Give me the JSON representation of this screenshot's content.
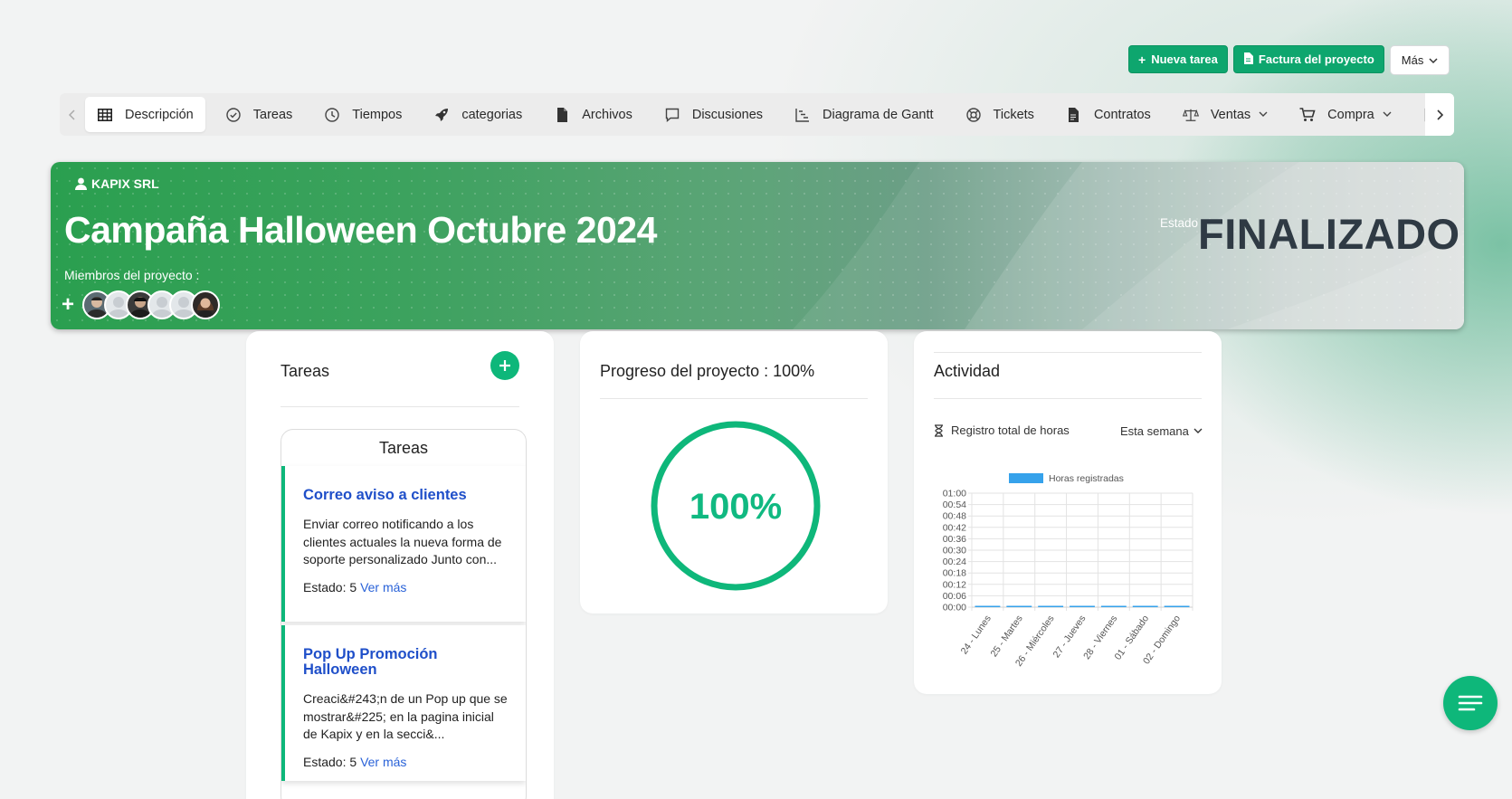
{
  "actions": {
    "new_task": "Nueva tarea",
    "invoice": "Factura del proyecto",
    "more": "Más"
  },
  "tabs": [
    {
      "label": "Descripción",
      "icon": "grid-icon"
    },
    {
      "label": "Tareas",
      "icon": "check-circle-icon"
    },
    {
      "label": "Tiempos",
      "icon": "clock-icon"
    },
    {
      "label": "categorias",
      "icon": "rocket-icon"
    },
    {
      "label": "Archivos",
      "icon": "file-icon"
    },
    {
      "label": "Discusiones",
      "icon": "chat-icon"
    },
    {
      "label": "Diagrama de Gantt",
      "icon": "gantt-icon"
    },
    {
      "label": "Tickets",
      "icon": "lifebuoy-icon"
    },
    {
      "label": "Contratos",
      "icon": "contract-icon"
    },
    {
      "label": "Ventas",
      "icon": "scale-icon"
    },
    {
      "label": "Compra",
      "icon": "cart-icon"
    }
  ],
  "hero": {
    "client": "KAPIX SRL",
    "title": "Campaña Halloween Octubre 2024",
    "members_label": "Miembros del proyecto :",
    "status_label": "Estado",
    "status_value": "FINALIZADO"
  },
  "tasks_card": {
    "title": "Tareas",
    "inner_title": "Tareas",
    "items": [
      {
        "title": "Correo aviso a clientes",
        "desc": "Enviar correo notificando a los clientes actuales la nueva forma de soporte personalizado Junto con...",
        "status_label": "Estado:",
        "status_value": "5",
        "more": "Ver más"
      },
      {
        "title": "Pop Up Promoción Halloween",
        "desc": "Creaci&#243;n de un Pop up que se mostrar&#225; en la pagina inicial de Kapix y en la secci&...",
        "status_label": "Estado:",
        "status_value": "5",
        "more": "Ver más"
      }
    ]
  },
  "progress_card": {
    "title": "Progreso del proyecto : 100%",
    "value_text": "100%",
    "progress": 100,
    "color": "#0eb77a"
  },
  "activity_card": {
    "title": "Actividad",
    "subtitle": "Registro total de horas",
    "range": "Esta semana"
  },
  "chart_data": {
    "type": "bar",
    "categories": [
      "24 - Lunes",
      "25 - Martes",
      "26 - Miércoles",
      "27 - Jueves",
      "28 - Viernes",
      "01 - Sábado",
      "02 - Domingo"
    ],
    "series": [
      {
        "name": "Horas registradas",
        "values": [
          0,
          0,
          0,
          0,
          0,
          0,
          0
        ],
        "color": "#36a2eb"
      }
    ],
    "y_ticks": [
      "00:00",
      "00:06",
      "00:12",
      "00:18",
      "00:24",
      "00:30",
      "00:36",
      "00:42",
      "00:48",
      "00:54",
      "01:00"
    ],
    "ylim": [
      0,
      60
    ],
    "grid": true,
    "legend": "top"
  },
  "colors": {
    "accent": "#0eb77a",
    "link": "#1f4fc9",
    "status_text": "#2f3a44"
  }
}
